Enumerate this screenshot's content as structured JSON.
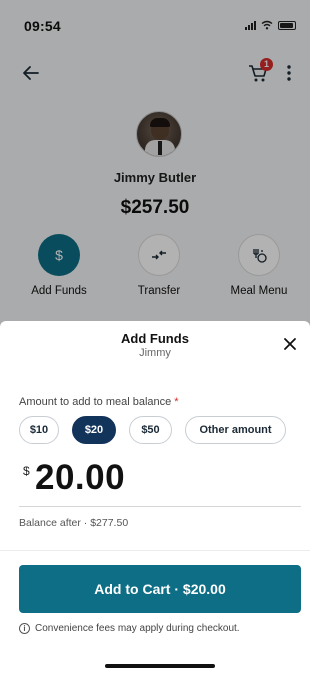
{
  "status_bar": {
    "time": "09:54"
  },
  "header": {
    "cart_badge_count": "1"
  },
  "student": {
    "name": "Jimmy Butler",
    "balance": "$257.50"
  },
  "actions": [
    {
      "label": "Add Funds",
      "icon": "dollar-icon"
    },
    {
      "label": "Transfer",
      "icon": "transfer-arrows-icon"
    },
    {
      "label": "Meal Menu",
      "icon": "meal-menu-icon"
    }
  ],
  "sheet": {
    "title": "Add Funds",
    "subtitle": "Jimmy",
    "amount_label": "Amount to add to meal balance",
    "required_marker": "*",
    "presets": [
      {
        "label": "$10",
        "selected": false
      },
      {
        "label": "$20",
        "selected": true
      },
      {
        "label": "$50",
        "selected": false
      },
      {
        "label": "Other amount",
        "selected": false
      }
    ],
    "currency_symbol": "$",
    "amount_value": "20.00",
    "balance_after": "Balance after · $277.50",
    "cta_label": "Add to Cart · $20.00",
    "fee_note": "Convenience fees may apply during checkout."
  },
  "colors": {
    "primary": "#0e6e86",
    "chip_selected": "#12335a",
    "required": "#d62b2b",
    "badge": "#d62b2b"
  }
}
